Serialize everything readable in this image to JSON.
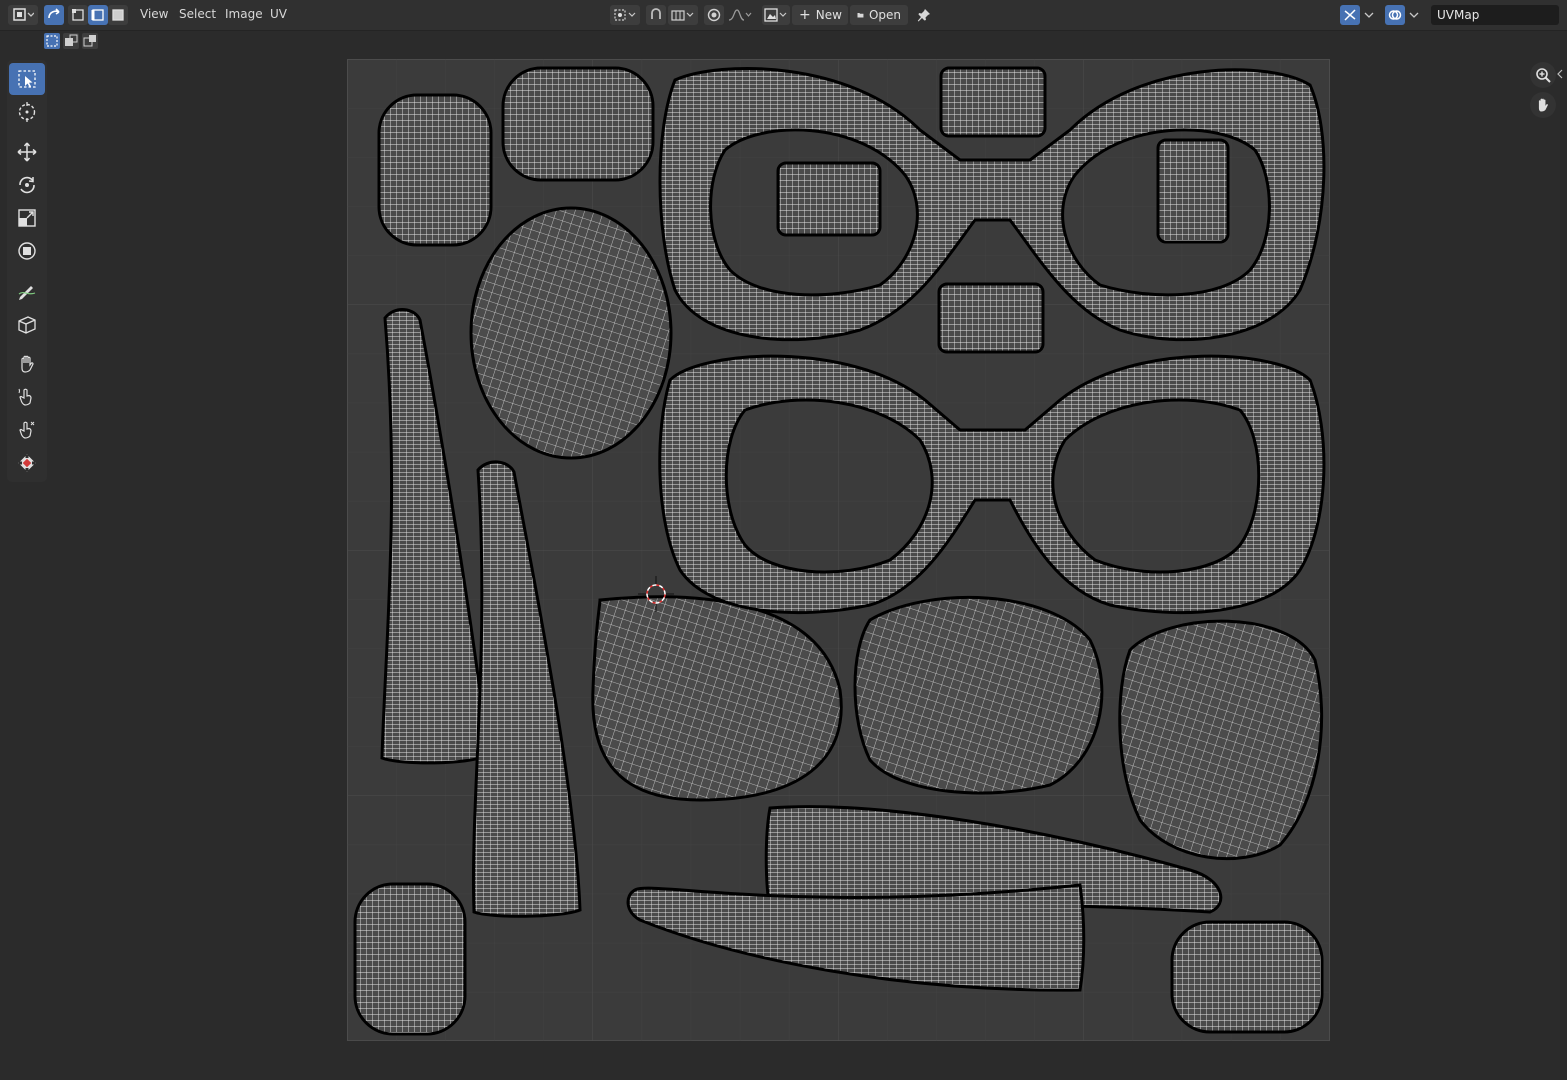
{
  "header": {
    "menus": [
      "View",
      "Select",
      "Image",
      "UV"
    ],
    "new_label": "New",
    "open_label": "Open",
    "uvmap_label": "UVMap"
  },
  "colors": {
    "accent": "#4772b3",
    "header_bg": "#303030",
    "viewport_bg": "#2b2b2b",
    "uv_area_bg": "#3b3b3b",
    "wire": "#e8e8e8",
    "seam": "#000000",
    "cursor": "#e03030"
  },
  "icons": {
    "editor_type": "image-editor-icon",
    "sync_selection": "sync-selection-icon",
    "select_vertex": "vertex-select-icon",
    "select_edge": "edge-select-icon",
    "select_face": "face-select-icon",
    "snap": "snap-icon",
    "proportional": "proportional-edit-icon",
    "pin": "pin-icon",
    "overlay": "overlay-icon",
    "gizmo": "gizmo-icon"
  },
  "toolbar": [
    {
      "name": "tool-select-box",
      "icon": "select-box-icon",
      "active": true
    },
    {
      "name": "tool-cursor",
      "icon": "cursor-icon",
      "active": false
    },
    {
      "name": "tool-move",
      "icon": "move-icon",
      "active": false
    },
    {
      "name": "tool-rotate",
      "icon": "rotate-icon",
      "active": false
    },
    {
      "name": "tool-scale",
      "icon": "scale-icon",
      "active": false
    },
    {
      "name": "tool-transform",
      "icon": "transform-icon",
      "active": false
    },
    {
      "name": "tool-annotate",
      "icon": "annotate-icon",
      "active": false
    },
    {
      "name": "tool-rip",
      "icon": "rip-icon",
      "active": false
    },
    {
      "name": "tool-grab",
      "icon": "grab-icon",
      "active": false
    },
    {
      "name": "tool-relax",
      "icon": "relax-icon",
      "active": false
    },
    {
      "name": "tool-pinch",
      "icon": "pinch-icon",
      "active": false
    },
    {
      "name": "tool-sample",
      "icon": "sample-icon",
      "active": false
    }
  ]
}
